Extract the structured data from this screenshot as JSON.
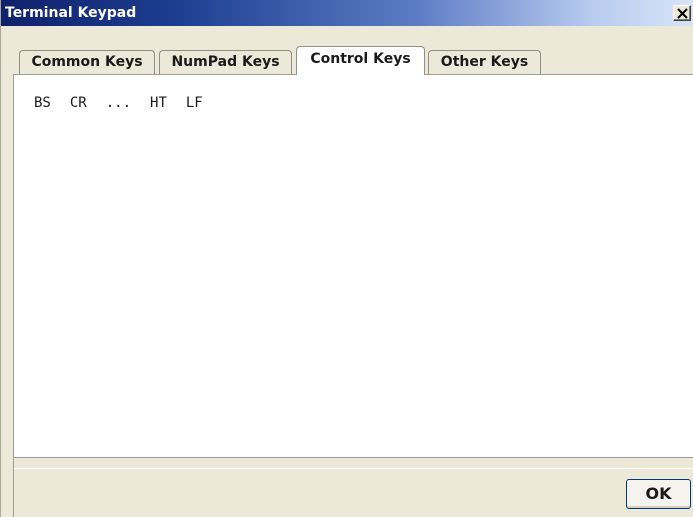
{
  "window": {
    "title": "Terminal Keypad",
    "close_label": "×"
  },
  "tabs": [
    {
      "label": "Common Keys",
      "selected": false
    },
    {
      "label": "NumPad Keys",
      "selected": false
    },
    {
      "label": "Control Keys",
      "selected": true
    },
    {
      "label": "Other Keys",
      "selected": false
    }
  ],
  "control_keys": [
    "BS",
    "CR",
    "...",
    "HT",
    "LF"
  ],
  "footer": {
    "ok_label": "OK"
  },
  "colors": {
    "titlebar_start": "#10216c",
    "titlebar_end": "#d9e4f7",
    "dialog_face": "#ece9d8",
    "content_bg": "#ffffff"
  }
}
